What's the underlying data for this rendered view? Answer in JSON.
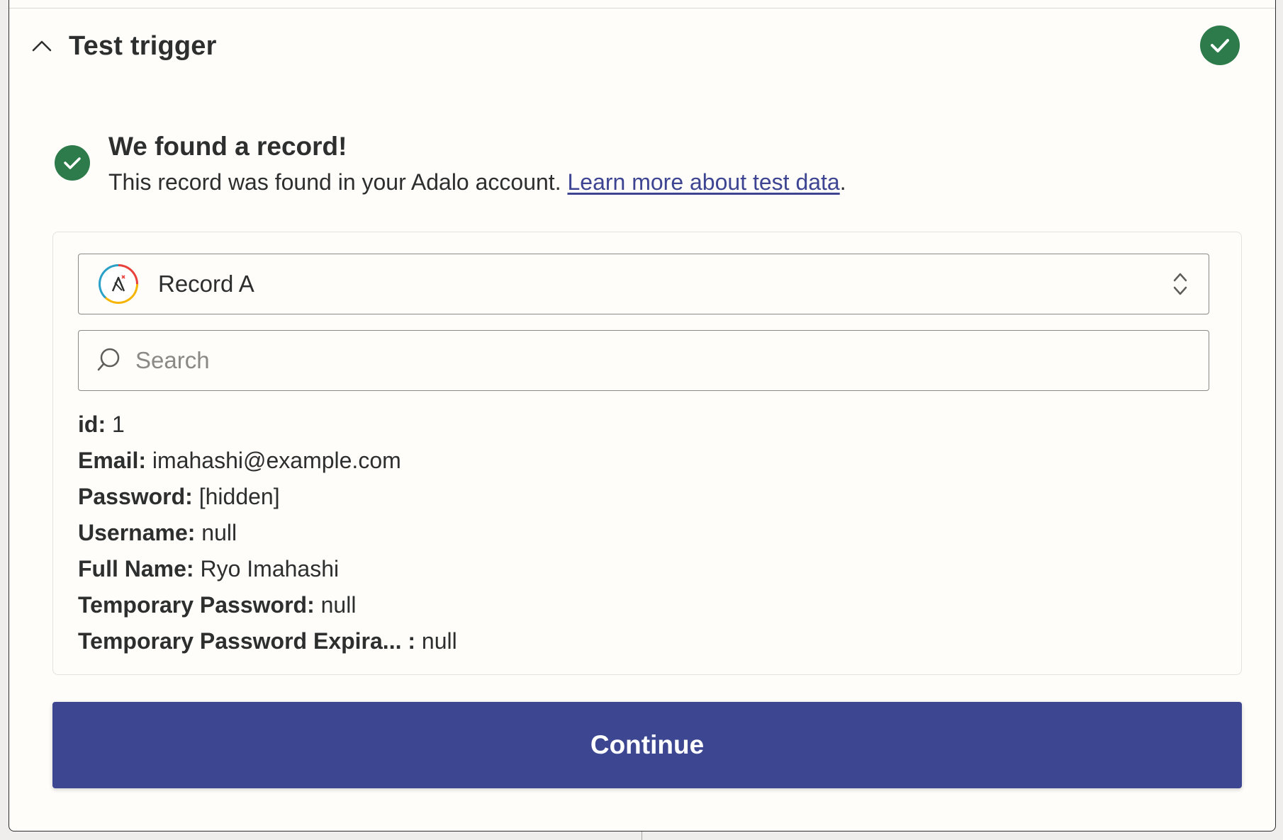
{
  "header": {
    "title": "Test trigger"
  },
  "result": {
    "title": "We found a record!",
    "description": "This record was found in your Adalo account. ",
    "link_text": "Learn more about test data",
    "period": "."
  },
  "record_select": {
    "selected": "Record A",
    "app_icon": "adalo-logo-icon"
  },
  "search": {
    "placeholder": "Search",
    "value": ""
  },
  "fields": [
    {
      "key": "id:",
      "value": " 1"
    },
    {
      "key": "Email:",
      "value": " imahashi@example.com"
    },
    {
      "key": "Password:",
      "value": " [hidden]"
    },
    {
      "key": "Username:",
      "value": " null"
    },
    {
      "key": "Full Name:",
      "value": " Ryo Imahashi"
    },
    {
      "key": "Temporary Password:",
      "value": " null"
    },
    {
      "key": "Temporary Password Expira... :",
      "value": " null"
    }
  ],
  "actions": {
    "continue_label": "Continue"
  },
  "colors": {
    "success": "#2d7a4a",
    "primary": "#3d4690",
    "link": "#3d4592"
  }
}
